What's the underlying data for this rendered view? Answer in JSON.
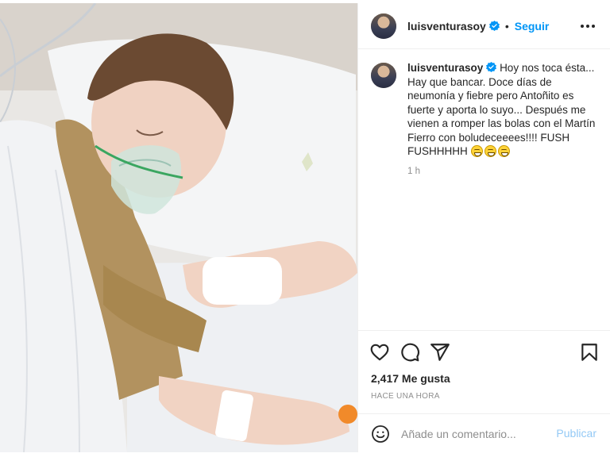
{
  "header": {
    "username": "luisventurasoy",
    "separator": "•",
    "follow_label": "Seguir"
  },
  "caption": {
    "username": "luisventurasoy",
    "text": "Hoy nos toca ésta... Hay que bancar. Doce días de neumonía y fiebre pero Antoñito es fuerte y aporta lo suyo... Después me vienen a romper las bolas con el Martín Fierro con boludeceeees!!!! FUSH FUSHHHHH",
    "emojis": [
      "grin-emoji",
      "grin-emoji",
      "grin-emoji"
    ],
    "time": "1 h"
  },
  "actions": {
    "icons": [
      "heart-icon",
      "comment-icon",
      "share-icon",
      "bookmark-icon"
    ],
    "likes": "2,417 Me gusta",
    "post_time": "HACE UNA HORA"
  },
  "comment": {
    "placeholder": "Añade un comentario...",
    "publish_label": "Publicar"
  },
  "colors": {
    "accent": "#0095f6",
    "publish_disabled": "#93c9f5",
    "verified": "#0095f6",
    "muted": "#8e8e8e",
    "border": "#efefef"
  }
}
